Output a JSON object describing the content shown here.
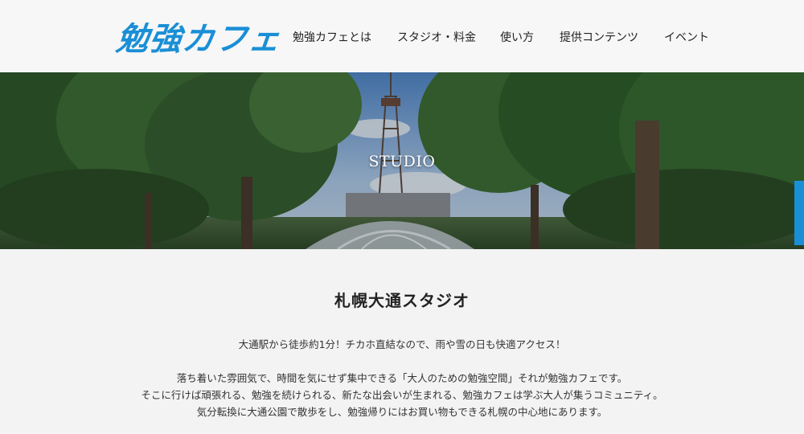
{
  "header": {
    "logo_text": "勉強カフェ",
    "nav": [
      "勉強カフェとは",
      "スタジオ・料金",
      "使い方",
      "提供コンテンツ",
      "イベント"
    ]
  },
  "hero": {
    "title": "STUDIO"
  },
  "main": {
    "heading": "札幌大通スタジオ",
    "paragraph1": "大通駅から徒歩約1分！チカホ直結なので、雨や雪の日も快適アクセス！",
    "paragraph2_lines": [
      "落ち着いた雰囲気で、時間を気にせず集中できる「大人のための勉強空間」それが勉強カフェです。",
      "そこに行けば頑張れる、勉強を続けられる、新たな出会いが生まれる、勉強カフェは学ぶ大人が集うコミュニティ。",
      "気分転換に大通公園で散歩をし、勉強帰りにはお買い物もできる札幌の中心地にあります。"
    ]
  },
  "colors": {
    "brand": "#1a8fd6",
    "background": "#f3f3f3"
  }
}
